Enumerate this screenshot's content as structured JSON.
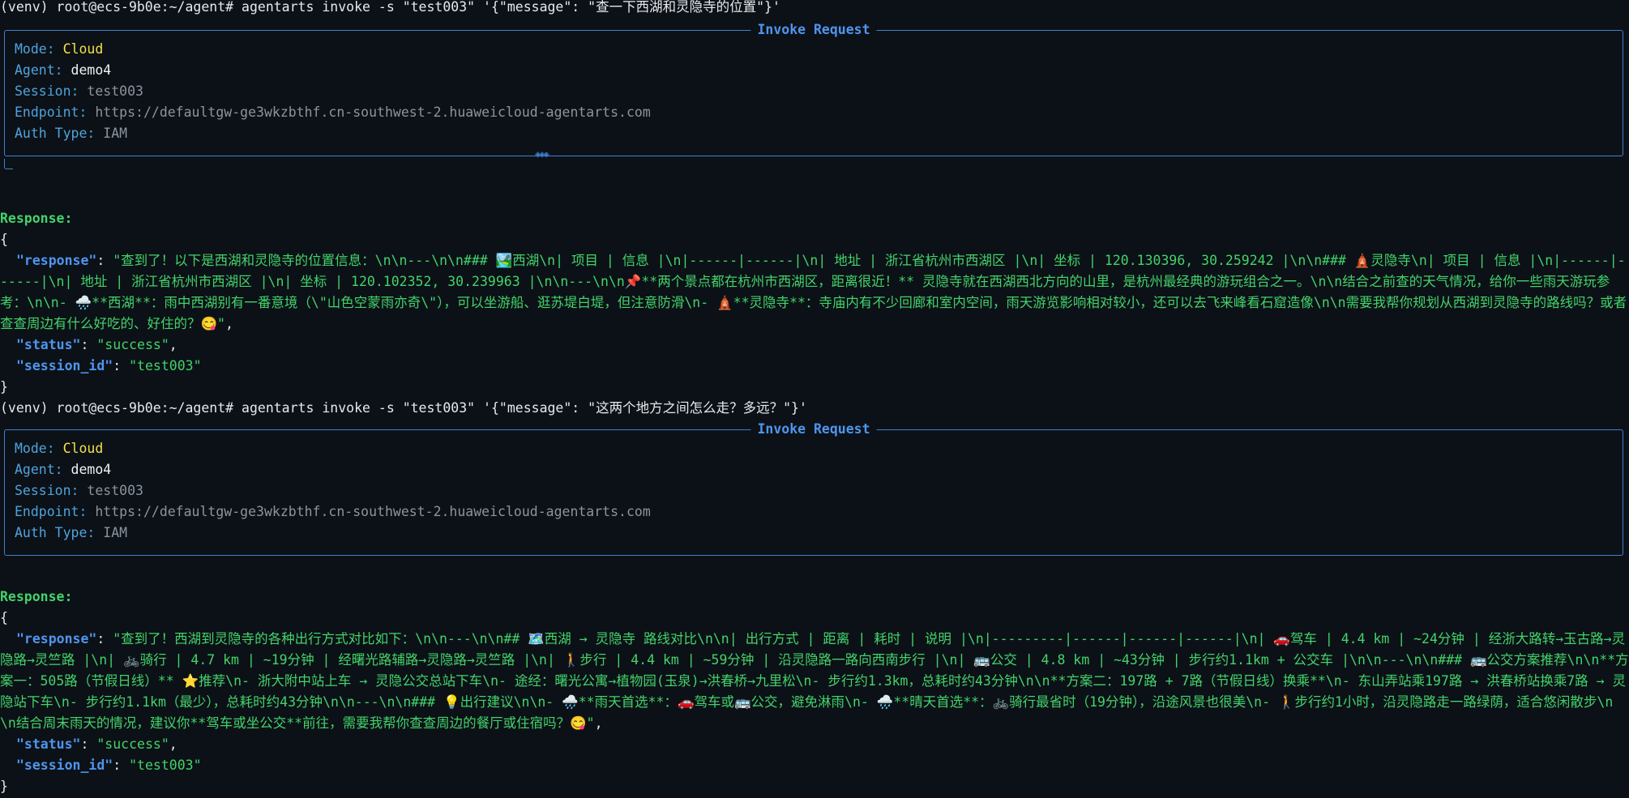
{
  "terminal": {
    "cmd1": "(venv) root@ecs-9b0e:~/agent# agentarts invoke -s \"test003\" '{\"message\": \"查一下西湖和灵隐寺的位置\"}'",
    "cmd2": "(venv) root@ecs-9b0e:~/agent# agentarts invoke -s \"test003\" '{\"message\": \"这两个地方之间怎么走？多远？\"}'"
  },
  "panel": {
    "title": "Invoke Request",
    "mode_key": "Mode:",
    "mode_val": "Cloud",
    "agent_key": "Agent:",
    "agent_val": "demo4",
    "session_key": "Session:",
    "session_val": "test003",
    "endpoint_key": "Endpoint:",
    "endpoint_val": "https://defaultgw-ge3wkzbthf.cn-southwest-2.huaweicloud-agentarts.com",
    "auth_key": "Auth Type:",
    "auth_val": "IAM",
    "handle": "◈◈◈"
  },
  "response": {
    "label": "Response:",
    "open": "{",
    "close": "}",
    "k_response": "\"response\"",
    "k_status": "\"status\"",
    "k_session": "\"session_id\"",
    "status_val": "\"success\"",
    "session_val": "\"test003\"",
    "text1": "\"查到了！以下是西湖和灵隐寺的位置信息：\\n\\n---\\n\\n### 🏞️西湖\\n| 项目 | 信息 |\\n|------|------|\\n| 地址 | 浙江省杭州市西湖区 |\\n| 坐标 | 120.130396, 30.259242 |\\n\\n### 🛕灵隐寺\\n| 项目 | 信息 |\\n|------|------|\\n| 地址 | 浙江省杭州市西湖区 |\\n| 坐标 | 120.102352, 30.239963 |\\n\\n---\\n\\n📌**两个景点都在杭州市西湖区，距离很近！** 灵隐寺就在西湖西北方向的山里，是杭州最经典的游玩组合之一。\\n\\n结合之前查的天气情况，给你一些雨天游玩参考：\\n\\n- 🌧️**西湖**：雨中西湖别有一番意境（\\\"山色空蒙雨亦奇\\\"），可以坐游船、逛苏堤白堤，但注意防滑\\n- 🛕**灵隐寺**：寺庙内有不少回廊和室内空间，雨天游览影响相对较小，还可以去飞来峰看石窟造像\\n\\n需要我帮你规划从西湖到灵隐寺的路线吗？或者查查周边有什么好吃的、好住的？😋\"",
    "text2": "\"查到了！西湖到灵隐寺的各种出行方式对比如下：\\n\\n---\\n\\n## 🗺️西湖 → 灵隐寺 路线对比\\n\\n| 出行方式 | 距离 | 耗时 | 说明 |\\n|---------|------|------|------|\\n| 🚗驾车 | 4.4 km | ~24分钟 | 经浙大路转→玉古路→灵隐路→灵竺路 |\\n| 🚲骑行 | 4.7 km | ~19分钟 | 经曙光路辅路→灵隐路→灵竺路 |\\n| 🚶步行 | 4.4 km | ~59分钟 | 沿灵隐路一路向西南步行 |\\n| 🚌公交 | 4.8 km | ~43分钟 | 步行约1.1km + 公交车 |\\n\\n---\\n\\n### 🚌公交方案推荐\\n\\n**方案一：505路（节假日线）** ⭐推荐\\n- 浙大附中站上车 → 灵隐公交总站下车\\n- 途经：曙光公寓→植物园(玉泉)→洪春桥→九里松\\n- 步行约1.3km，总耗时约43分钟\\n\\n**方案二：197路 + 7路（节假日线）换乘**\\n- 东山弄站乘197路 → 洪春桥站换乘7路 → 灵隐站下车\\n- 步行约1.1km（最少），总耗时约43分钟\\n\\n---\\n\\n### 💡出行建议\\n\\n- 🌧️**雨天首选**：🚗驾车或🚌公交，避免淋雨\\n- 🌧️**晴天首选**：🚲骑行最省时（19分钟），沿途风景也很美\\n- 🚶步行约1小时，沿灵隐路走一路绿荫，适合悠闲散步\\n\\n结合周末雨天的情况，建议你**驾车或坐公交**前往，需要我帮你查查周边的餐厅或住宿吗？😋\""
  }
}
